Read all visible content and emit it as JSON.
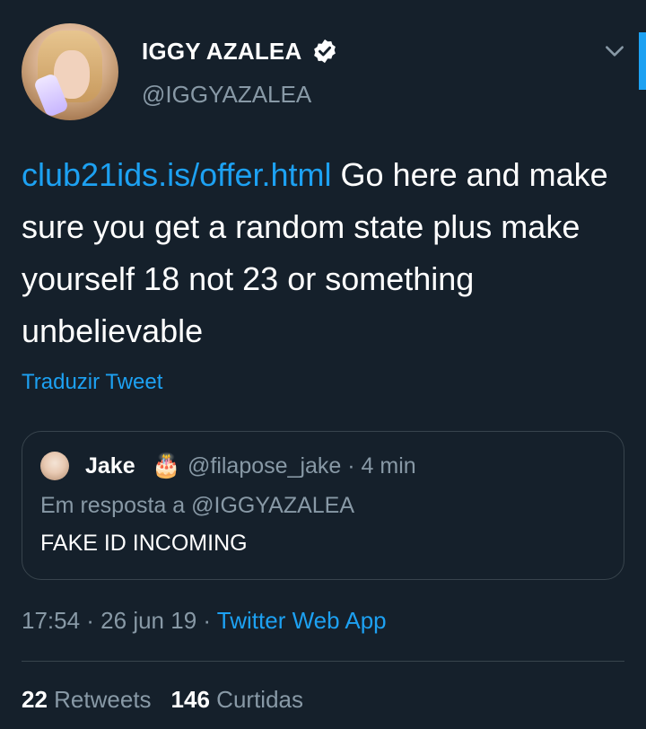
{
  "author": {
    "display_name": "IGGY AZALEA",
    "handle": "@IGGYAZALEA"
  },
  "tweet": {
    "link_text": "club21ids.is/offer.html",
    "body": " Go here and make sure you get a random state plus make yourself 18 not 23 or something unbelievable",
    "translate_label": "Traduzir Tweet"
  },
  "quoted": {
    "name": "Jake",
    "emoji": "🎂",
    "meta": "@filapose_jake · 4 min",
    "reply_to": "Em resposta a @IGGYAZALEA",
    "text": "FAKE ID INCOMING"
  },
  "timestamp": {
    "time_date": "17:54 · 26 jun 19 · ",
    "source": "Twitter Web App"
  },
  "stats": {
    "retweets_count": "22",
    "retweets_label": "Retweets",
    "likes_count": "146",
    "likes_label": "Curtidas"
  },
  "icons": {
    "verified": "verified-badge-icon",
    "menu": "chevron-down-icon"
  },
  "colors": {
    "background": "#15202b",
    "accent": "#1da1f2",
    "muted": "#8899a6",
    "border": "#38444d"
  }
}
